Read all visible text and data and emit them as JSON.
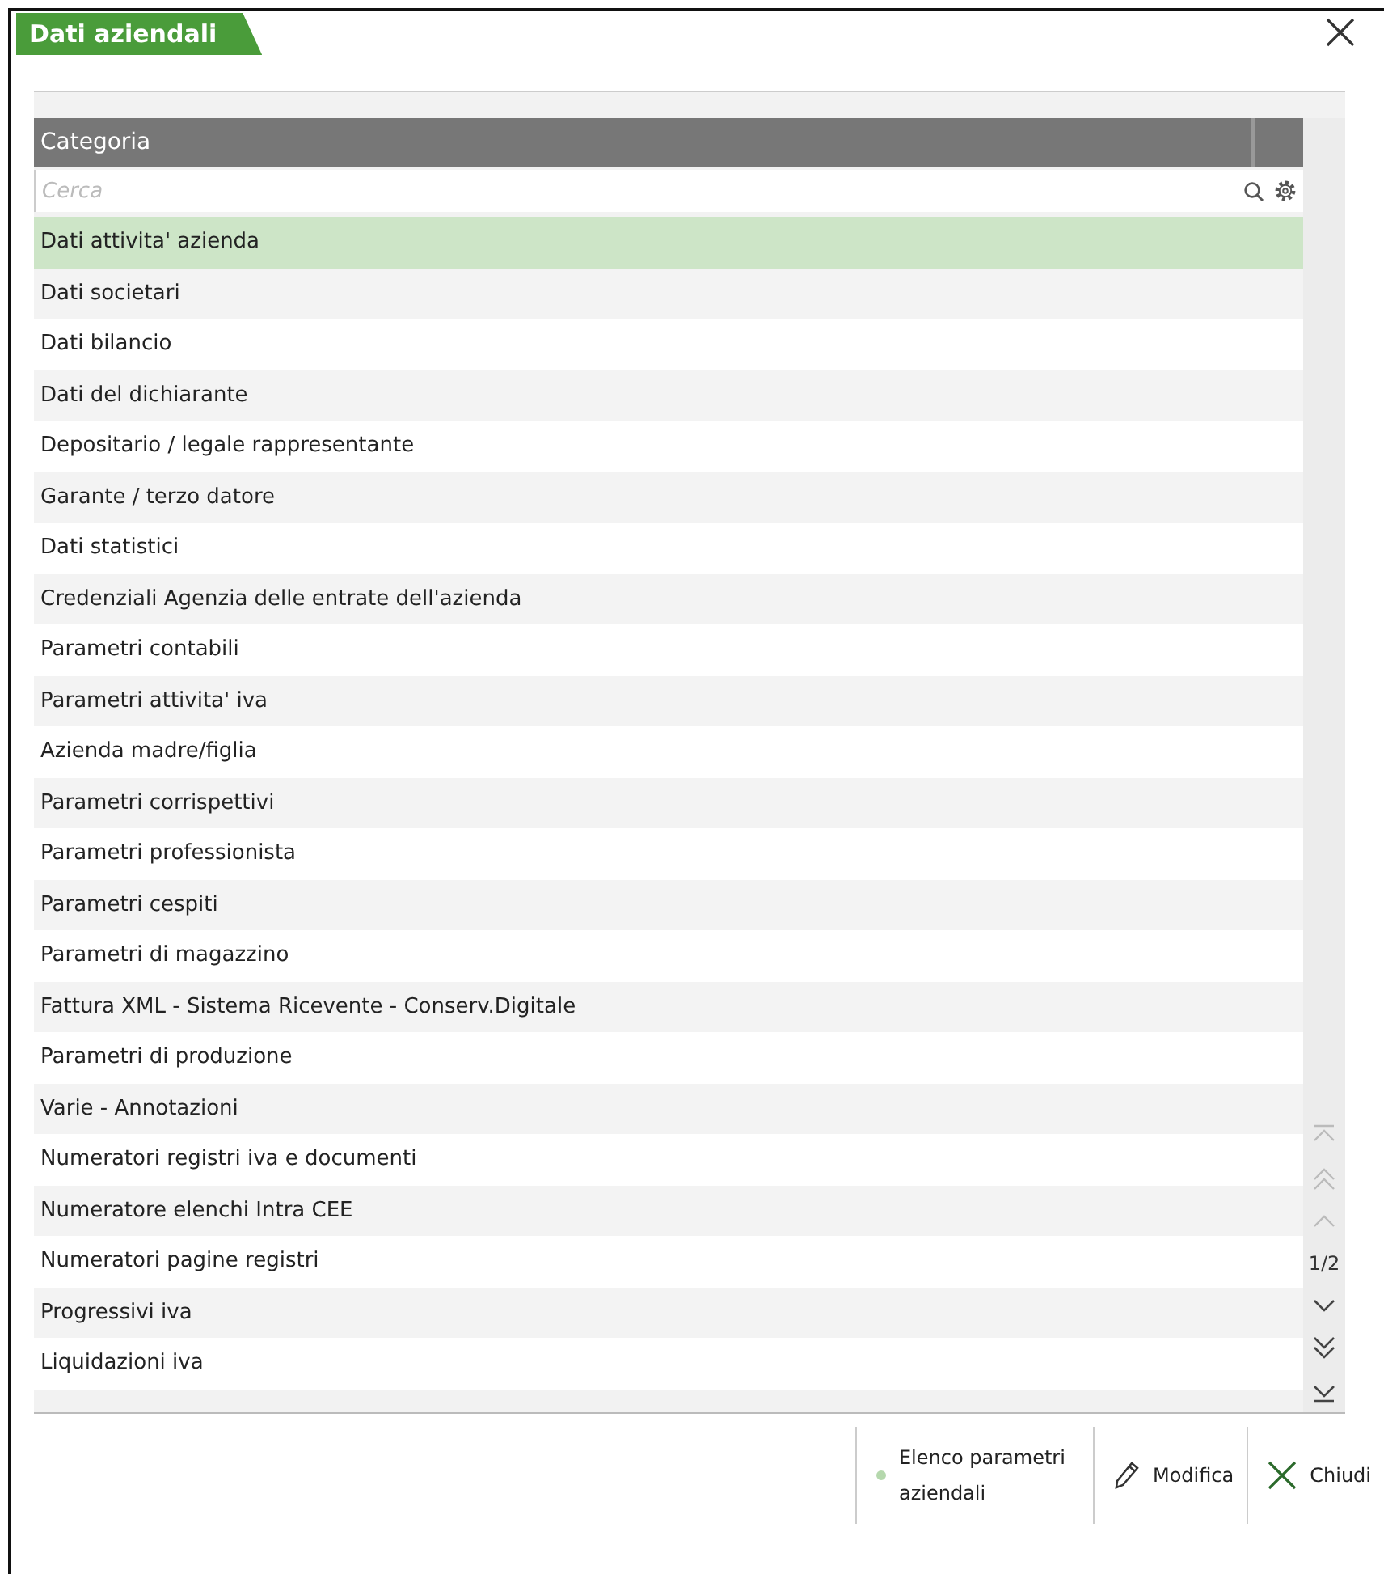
{
  "window": {
    "title": "Dati aziendali"
  },
  "table": {
    "columns": [
      "Categoria"
    ],
    "search": {
      "placeholder": "Cerca"
    },
    "rows": [
      {
        "label": "Dati attivita' azienda",
        "selected": true
      },
      {
        "label": "Dati societari",
        "selected": false
      },
      {
        "label": "Dati bilancio",
        "selected": false
      },
      {
        "label": "Dati del dichiarante",
        "selected": false
      },
      {
        "label": "Depositario / legale rappresentante",
        "selected": false
      },
      {
        "label": "Garante / terzo datore",
        "selected": false
      },
      {
        "label": "Dati statistici",
        "selected": false
      },
      {
        "label": "Credenziali Agenzia delle entrate dell'azienda",
        "selected": false
      },
      {
        "label": "Parametri contabili",
        "selected": false
      },
      {
        "label": "Parametri attivita' iva",
        "selected": false
      },
      {
        "label": "Azienda madre/figlia",
        "selected": false
      },
      {
        "label": "Parametri corrispettivi",
        "selected": false
      },
      {
        "label": "Parametri professionista",
        "selected": false
      },
      {
        "label": "Parametri cespiti",
        "selected": false
      },
      {
        "label": "Parametri di magazzino",
        "selected": false
      },
      {
        "label": "Fattura XML - Sistema Ricevente - Conserv.Digitale",
        "selected": false
      },
      {
        "label": "Parametri di produzione",
        "selected": false
      },
      {
        "label": "Varie - Annotazioni",
        "selected": false
      },
      {
        "label": "Numeratori registri iva e documenti",
        "selected": false
      },
      {
        "label": "Numeratore elenchi Intra CEE",
        "selected": false
      },
      {
        "label": "Numeratori pagine registri",
        "selected": false
      },
      {
        "label": "Progressivi iva",
        "selected": false
      },
      {
        "label": "Liquidazioni iva",
        "selected": false
      }
    ],
    "page": "1/2"
  },
  "footer": {
    "buttons": [
      {
        "kind": "dot",
        "label": "Elenco parametri aziendali"
      },
      {
        "kind": "edit",
        "label": "Modifica"
      },
      {
        "kind": "close",
        "label": "Chiudi"
      }
    ]
  }
}
